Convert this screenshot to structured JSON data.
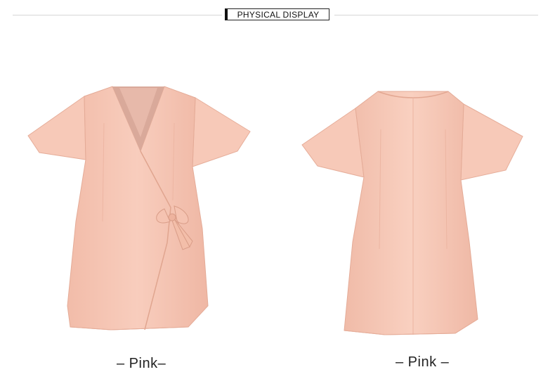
{
  "header": {
    "title": "PHYSICAL DISPLAY"
  },
  "products": [
    {
      "view": "front",
      "caption": "– Pink–"
    },
    {
      "view": "back",
      "caption": "– Pink –"
    }
  ],
  "colors": {
    "dress": "#f6c7b6",
    "dress_shadow": "#e9b19f",
    "dress_highlight": "#fbd8cb",
    "lining": "#d9a99a"
  }
}
